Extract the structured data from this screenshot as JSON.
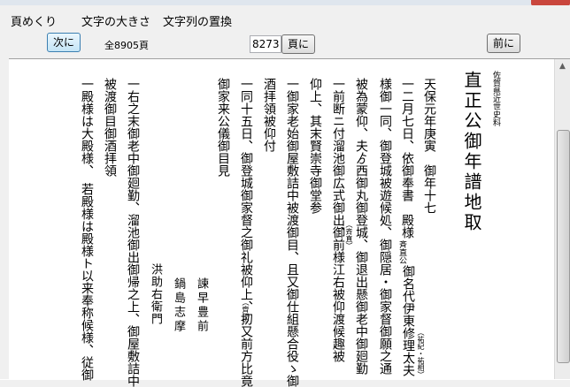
{
  "menu": {
    "items": [
      {
        "label": "頁めくり"
      },
      {
        "label": "文字の大きさ"
      },
      {
        "label": "文字列の置換"
      }
    ]
  },
  "toolbar": {
    "next_label": "次に",
    "total_pages": "全8905頁",
    "page_value": "8273",
    "goto_label": "頁に",
    "prev_label": "前に"
  },
  "document": {
    "source": "佐賀県近世史料",
    "title": "直正公御年譜地取",
    "lines": [
      "天保元年庚寅　御年十七",
      "一二月七日、依御奉書　殿様",
      "様御一同、御登城被遊候処、御隠居・御家督御願之通",
      "被為蒙仰、夫ゟ西御丸御登城、御退出懸御老中御廻勤",
      "一前断ニ付溜池御広式御出、",
      "仰上、其末賢崇寺御堂参",
      "一御家老始御屋敷詰中被渡御目、且又御仕組懸合役ゝ御",
      "酒拝領被仰付",
      "一同十五日、御登城御家督之御礼被仰上、扨又前方比竟",
      "御家来公儀御目見",
      "一右之末御老中御廻勤、溜池御出御帰之上、御屋敷詰中",
      "被渡御目御酒拝領",
      "一殿様は大殿様、　若殿様は殿様ト以来奉称候様、従御"
    ],
    "small_notes": [
      "斉直公",
      "御名代伊東修理太夫",
      "（祐紀・祐相）",
      "（斉直）",
      "御前様江右被仰渡候趣被",
      "（齊正）"
    ],
    "signatures": [
      "諫早豊前",
      "鍋島志摩",
      "洪助右衛門"
    ]
  }
}
